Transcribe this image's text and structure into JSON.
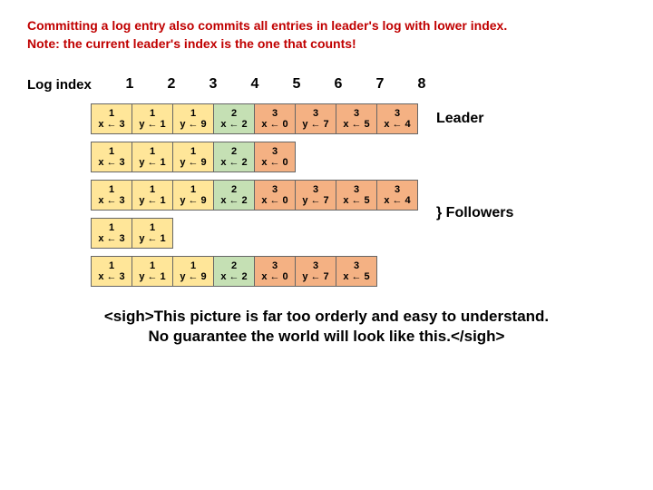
{
  "title1": "Committing a log entry also commits all entries in leader's log with lower index.",
  "title2": "Note: the current leader's index is the one that counts!",
  "log_index_label": "Log index",
  "indices": [
    "1",
    "2",
    "3",
    "4",
    "5",
    "6",
    "7",
    "8"
  ],
  "leader_label": "Leader",
  "followers_label": "Followers",
  "rows": [
    [
      {
        "term": "1",
        "cmd": "x ← 3",
        "t": 1
      },
      {
        "term": "1",
        "cmd": "y ← 1",
        "t": 1
      },
      {
        "term": "1",
        "cmd": "y ← 9",
        "t": 1
      },
      {
        "term": "2",
        "cmd": "x ← 2",
        "t": 2
      },
      {
        "term": "3",
        "cmd": "x ← 0",
        "t": 3
      },
      {
        "term": "3",
        "cmd": "y ← 7",
        "t": 3
      },
      {
        "term": "3",
        "cmd": "x ← 5",
        "t": 3
      },
      {
        "term": "3",
        "cmd": "x ← 4",
        "t": 3
      }
    ],
    [
      {
        "term": "1",
        "cmd": "x ← 3",
        "t": 1
      },
      {
        "term": "1",
        "cmd": "y ← 1",
        "t": 1
      },
      {
        "term": "1",
        "cmd": "y ← 9",
        "t": 1
      },
      {
        "term": "2",
        "cmd": "x ← 2",
        "t": 2
      },
      {
        "term": "3",
        "cmd": "x ← 0",
        "t": 3
      }
    ],
    [
      {
        "term": "1",
        "cmd": "x ← 3",
        "t": 1
      },
      {
        "term": "1",
        "cmd": "y ← 1",
        "t": 1
      },
      {
        "term": "1",
        "cmd": "y ← 9",
        "t": 1
      },
      {
        "term": "2",
        "cmd": "x ← 2",
        "t": 2
      },
      {
        "term": "3",
        "cmd": "x ← 0",
        "t": 3
      },
      {
        "term": "3",
        "cmd": "y ← 7",
        "t": 3
      },
      {
        "term": "3",
        "cmd": "x ← 5",
        "t": 3
      },
      {
        "term": "3",
        "cmd": "x ← 4",
        "t": 3
      }
    ],
    [
      {
        "term": "1",
        "cmd": "x ← 3",
        "t": 1
      },
      {
        "term": "1",
        "cmd": "y ← 1",
        "t": 1
      }
    ],
    [
      {
        "term": "1",
        "cmd": "x ← 3",
        "t": 1
      },
      {
        "term": "1",
        "cmd": "y ← 1",
        "t": 1
      },
      {
        "term": "1",
        "cmd": "y ← 9",
        "t": 1
      },
      {
        "term": "2",
        "cmd": "x ← 2",
        "t": 2
      },
      {
        "term": "3",
        "cmd": "x ← 0",
        "t": 3
      },
      {
        "term": "3",
        "cmd": "y ← 7",
        "t": 3
      },
      {
        "term": "3",
        "cmd": "x ← 5",
        "t": 3
      }
    ]
  ],
  "sigh_line1": "<sigh>This picture is far too orderly and easy to understand.",
  "sigh_line2": "No guarantee the world will look like this.</sigh>"
}
